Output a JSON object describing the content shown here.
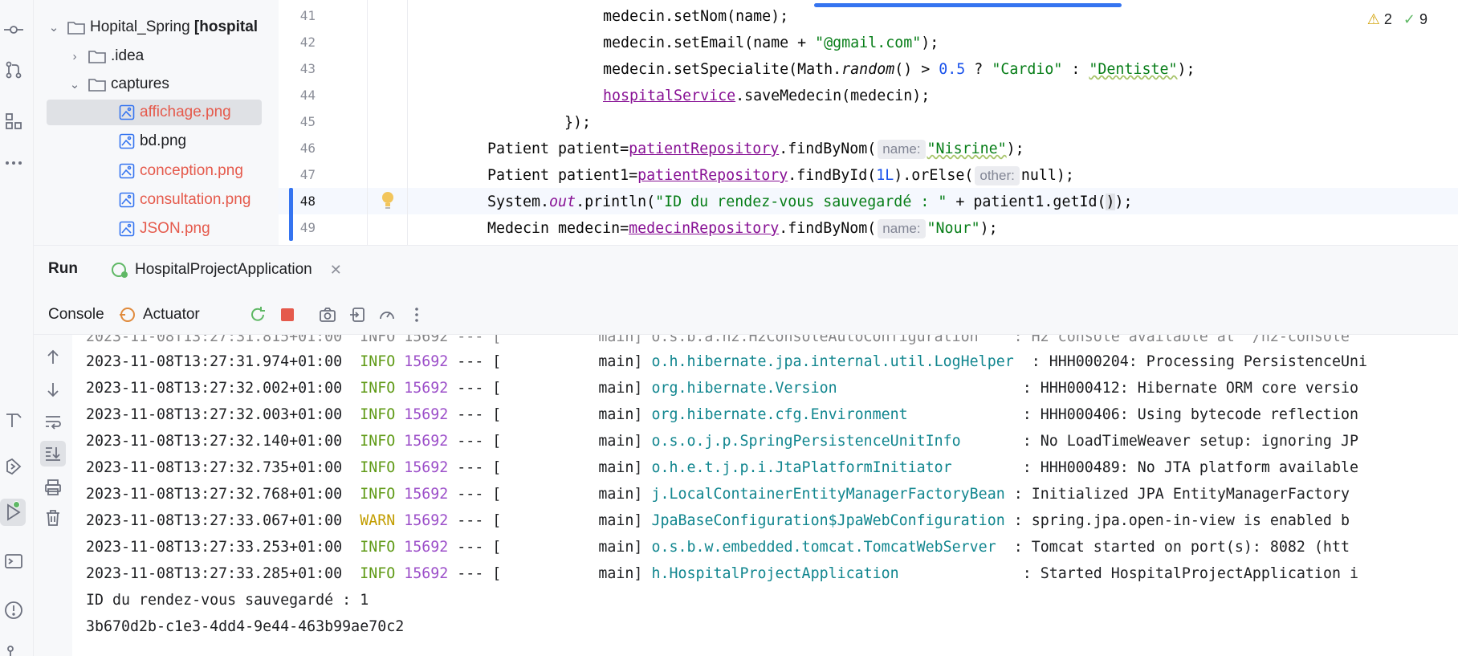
{
  "project": {
    "root": {
      "name": "Hopital_Spring",
      "module": "[hospital"
    },
    "items": [
      {
        "label": ".idea",
        "type": "folder",
        "expanded": false
      },
      {
        "label": "captures",
        "type": "folder",
        "expanded": true
      },
      {
        "label": "affichage.png",
        "type": "image",
        "modified": true,
        "selected": true
      },
      {
        "label": "bd.png",
        "type": "image",
        "modified": false
      },
      {
        "label": "conception.png",
        "type": "image",
        "modified": true
      },
      {
        "label": "consultation.png",
        "type": "image",
        "modified": true
      },
      {
        "label": "JSON.png",
        "type": "image",
        "modified": true
      }
    ]
  },
  "editor": {
    "inspections": {
      "warnings": "2",
      "ok": "9"
    },
    "line_numbers": [
      "41",
      "42",
      "43",
      "44",
      "45",
      "46",
      "47",
      "48",
      "49"
    ],
    "current_line": "48",
    "lines": {
      "l41": {
        "a": "medecin.setNom(name);"
      },
      "l42": {
        "a": "medecin.setEmail(name + ",
        "s": "\"@gmail.com\"",
        "b": ");"
      },
      "l43": {
        "a": "medecin.setSpecialite(Math.",
        "m": "random",
        "b": "() > ",
        "n": "0.5",
        "c": " ? ",
        "s1": "\"Cardio\"",
        "d": " : ",
        "s2": "\"Dentiste\"",
        "e": ");"
      },
      "l44": {
        "f": "hospitalService",
        "a": ".saveMedecin(medecin);"
      },
      "l45": {
        "a": "});"
      },
      "l46": {
        "a": "Patient patient=",
        "f": "patientRepository",
        "b": ".findByNom(",
        "hint": "name:",
        "s": "\"Nisrine\"",
        "c": ");"
      },
      "l47": {
        "a": "Patient patient1=",
        "f": "patientRepository",
        "b": ".findById(",
        "n": "1L",
        "c": ").orElse(",
        "hint": "other:",
        "d": "null);"
      },
      "l48": {
        "a": "System.",
        "o": "out",
        "b": ".println(",
        "s": "\"ID du rendez-vous sauvegardé : \"",
        "c": " + patient1.getId(",
        "d": ")",
        "e": ");"
      },
      "l49": {
        "a": "Medecin medecin=",
        "f": "medecinRepository",
        "b": ".findByNom(",
        "hint": "name:",
        "s": "\"Nour\"",
        "c": ");"
      }
    }
  },
  "run": {
    "title": "Run",
    "tab": "HospitalProjectApplication",
    "toolbar": {
      "console": "Console",
      "actuator": "Actuator"
    }
  },
  "console": {
    "logs": [
      {
        "ts": "2023-11-08T13:27:31.974+01:00",
        "level": "INFO",
        "pid": "15692",
        "sep": " --- [",
        "thread": "           main]",
        "logger": "o.h.hibernate.jpa.internal.util.LogHelper",
        "msg": "  : HHH000204: Processing PersistenceUni"
      },
      {
        "ts": "2023-11-08T13:27:32.002+01:00",
        "level": "INFO",
        "pid": "15692",
        "sep": " --- [",
        "thread": "           main]",
        "logger": "org.hibernate.Version",
        "msg": "                     : HHH000412: Hibernate ORM core versio"
      },
      {
        "ts": "2023-11-08T13:27:32.003+01:00",
        "level": "INFO",
        "pid": "15692",
        "sep": " --- [",
        "thread": "           main]",
        "logger": "org.hibernate.cfg.Environment",
        "msg": "             : HHH000406: Using bytecode reflection"
      },
      {
        "ts": "2023-11-08T13:27:32.140+01:00",
        "level": "INFO",
        "pid": "15692",
        "sep": " --- [",
        "thread": "           main]",
        "logger": "o.s.o.j.p.SpringPersistenceUnitInfo",
        "msg": "       : No LoadTimeWeaver setup: ignoring JP"
      },
      {
        "ts": "2023-11-08T13:27:32.735+01:00",
        "level": "INFO",
        "pid": "15692",
        "sep": " --- [",
        "thread": "           main]",
        "logger": "o.h.e.t.j.p.i.JtaPlatformInitiator",
        "msg": "        : HHH000489: No JTA platform available"
      },
      {
        "ts": "2023-11-08T13:27:32.768+01:00",
        "level": "INFO",
        "pid": "15692",
        "sep": " --- [",
        "thread": "           main]",
        "logger": "j.LocalContainerEntityManagerFactoryBean",
        "msg": " : Initialized JPA EntityManagerFactory"
      },
      {
        "ts": "2023-11-08T13:27:33.067+01:00",
        "level": "WARN",
        "pid": "15692",
        "sep": " --- [",
        "thread": "           main]",
        "logger": "JpaBaseConfiguration$JpaWebConfiguration",
        "msg": " : spring.jpa.open-in-view is enabled b"
      },
      {
        "ts": "2023-11-08T13:27:33.253+01:00",
        "level": "INFO",
        "pid": "15692",
        "sep": " --- [",
        "thread": "           main]",
        "logger": "o.s.b.w.embedded.tomcat.TomcatWebServer",
        "msg": "  : Tomcat started on port(s): 8082 (htt"
      },
      {
        "ts": "2023-11-08T13:27:33.285+01:00",
        "level": "INFO",
        "pid": "15692",
        "sep": " --- [",
        "thread": "           main]",
        "logger": "h.HospitalProjectApplication",
        "msg": "              : Started HospitalProjectApplication i"
      }
    ],
    "output": [
      "ID du rendez-vous sauvegardé : 1",
      "3b670d2b-c1e3-4dd4-9e44-463b99ae70c2"
    ]
  },
  "colors": {
    "accent": "#3574f0",
    "info": "#5f9a16",
    "warn": "#c29d00",
    "pid": "#9c4fc9",
    "logger": "#11868f",
    "modified_file": "#e55a4c"
  }
}
